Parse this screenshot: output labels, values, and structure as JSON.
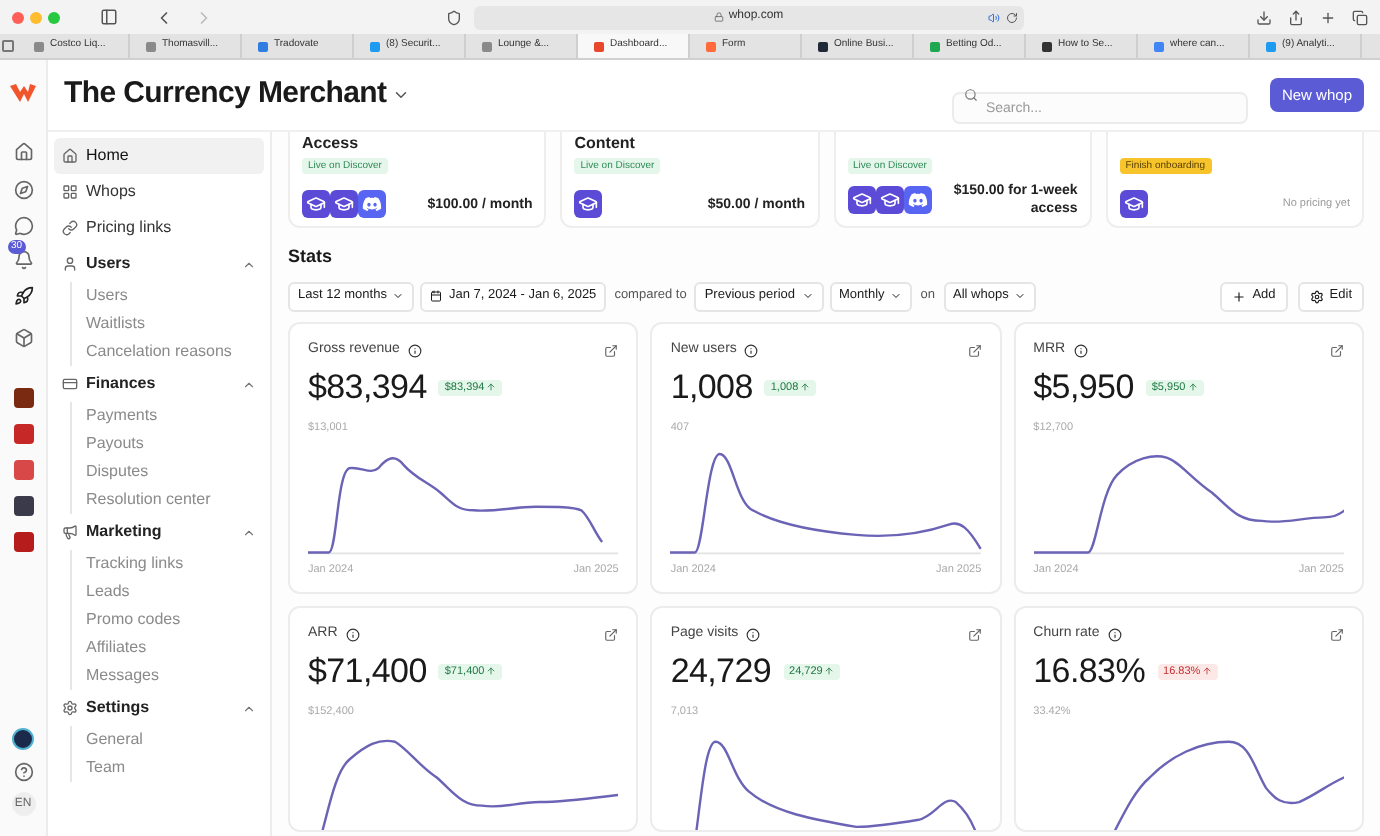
{
  "browser": {
    "url": "whop.com",
    "tabs": [
      {
        "label": "Costco Liq...",
        "selected": false,
        "color": "#8a8a8a"
      },
      {
        "label": "Thomasvill...",
        "selected": false,
        "color": "#8a8a8a"
      },
      {
        "label": "Tradovate",
        "selected": false,
        "color": "#2f7de1"
      },
      {
        "label": "(8) Securit...",
        "selected": false,
        "color": "#1d9bf0"
      },
      {
        "label": "Lounge &...",
        "selected": false,
        "color": "#8a8a8a"
      },
      {
        "label": "Dashboard...",
        "selected": true,
        "color": "#e8472b"
      },
      {
        "label": "Form",
        "selected": false,
        "color": "#ff6a3d"
      },
      {
        "label": "Online Busi...",
        "selected": false,
        "color": "#1f2937"
      },
      {
        "label": "Betting Od...",
        "selected": false,
        "color": "#1ea84f"
      },
      {
        "label": "How to Se...",
        "selected": false,
        "color": "#333333"
      },
      {
        "label": "where can...",
        "selected": false,
        "color": "#4285f4"
      },
      {
        "label": "(9) Analyti...",
        "selected": false,
        "color": "#1d9bf0"
      }
    ]
  },
  "header": {
    "title": "The Currency Merchant",
    "search": {
      "placeholder": "Search..."
    },
    "new_button": "New whop"
  },
  "rail": {
    "notification_badge": "30",
    "apps": [
      {
        "color": "#7a2a10"
      },
      {
        "color": "#c62828"
      },
      {
        "color": "#d84848"
      },
      {
        "color": "#3a3a4a"
      },
      {
        "color": "#b71c1c"
      }
    ],
    "language": "EN"
  },
  "sidebar": {
    "items": [
      {
        "label": "Home",
        "selected": true
      },
      {
        "label": "Whops",
        "selected": false
      },
      {
        "label": "Pricing links",
        "selected": false
      }
    ],
    "sections": [
      {
        "label": "Users",
        "expanded": true,
        "children": [
          {
            "label": "Users"
          },
          {
            "label": "Waitlists"
          },
          {
            "label": "Cancelation reasons"
          }
        ]
      },
      {
        "label": "Finances",
        "expanded": true,
        "children": [
          {
            "label": "Payments"
          },
          {
            "label": "Payouts"
          },
          {
            "label": "Disputes"
          },
          {
            "label": "Resolution center"
          }
        ]
      },
      {
        "label": "Marketing",
        "expanded": true,
        "children": [
          {
            "label": "Tracking links"
          },
          {
            "label": "Leads"
          },
          {
            "label": "Promo codes"
          },
          {
            "label": "Affiliates"
          },
          {
            "label": "Messages"
          }
        ]
      },
      {
        "label": "Settings",
        "expanded": true,
        "children": [
          {
            "label": "General"
          },
          {
            "label": "Team"
          }
        ]
      }
    ]
  },
  "whops": [
    {
      "title": "Access",
      "badge": {
        "label": "Live on Discover",
        "kind": "live"
      },
      "apps": [
        {
          "kind": "course"
        },
        {
          "kind": "course"
        },
        {
          "kind": "discord"
        }
      ],
      "price": "$100.00 / month",
      "price_muted": false
    },
    {
      "title": "Content",
      "badge": {
        "label": "Live on Discover",
        "kind": "live"
      },
      "apps": [
        {
          "kind": "course"
        }
      ],
      "price": "$50.00 / month",
      "price_muted": false
    },
    {
      "badge": {
        "label": "Live on Discover",
        "kind": "live"
      },
      "apps": [
        {
          "kind": "course"
        },
        {
          "kind": "course"
        },
        {
          "kind": "discord"
        }
      ],
      "price": "$150.00 for 1-week access",
      "price_muted": false
    },
    {
      "badge": {
        "label": "Finish onboarding",
        "kind": "pending"
      },
      "apps": [
        {
          "kind": "course"
        }
      ],
      "price": "No pricing yet",
      "price_muted": true
    }
  ],
  "stats": {
    "title": "Stats",
    "filters": [
      {
        "kind": "dropdown",
        "label": "Last 12 months"
      },
      {
        "kind": "date",
        "label": "Jan 7, 2024 - Jan 6, 2025"
      },
      {
        "kind": "text",
        "label": "compared to"
      },
      {
        "kind": "dropdown",
        "label": "Previous period"
      },
      {
        "kind": "dropdown",
        "label": "Monthly"
      },
      {
        "kind": "text",
        "label": "on"
      },
      {
        "kind": "dropdown",
        "label": "All whops"
      }
    ],
    "actions": [
      {
        "kind": "add",
        "label": "Add"
      },
      {
        "kind": "edit",
        "label": "Edit"
      }
    ],
    "metrics": [
      {
        "label": "Gross revenue",
        "value": "$83,394",
        "delta": {
          "label": "$83,394",
          "kind": "rise_good"
        },
        "max_label": "$13,001",
        "x_start": "Jan 2024",
        "x_end": "Jan 2025"
      },
      {
        "label": "New users",
        "value": "1,008",
        "delta": {
          "label": "1,008",
          "kind": "rise_good"
        },
        "max_label": "407",
        "x_start": "Jan 2024",
        "x_end": "Jan 2025"
      },
      {
        "label": "MRR",
        "value": "$5,950",
        "delta": {
          "label": "$5,950",
          "kind": "rise_good"
        },
        "max_label": "$12,700",
        "x_start": "Jan 2024",
        "x_end": "Jan 2025"
      },
      {
        "label": "ARR",
        "value": "$71,400",
        "delta": {
          "label": "$71,400",
          "kind": "rise_good"
        },
        "max_label": "$152,400"
      },
      {
        "label": "Page visits",
        "value": "24,729",
        "delta": {
          "label": "24,729",
          "kind": "rise_good"
        },
        "max_label": "7,013"
      },
      {
        "label": "Churn rate",
        "value": "16.83%",
        "delta": {
          "label": "16.83%",
          "kind": "rise_bad"
        },
        "max_label": "33.42%"
      }
    ]
  }
}
